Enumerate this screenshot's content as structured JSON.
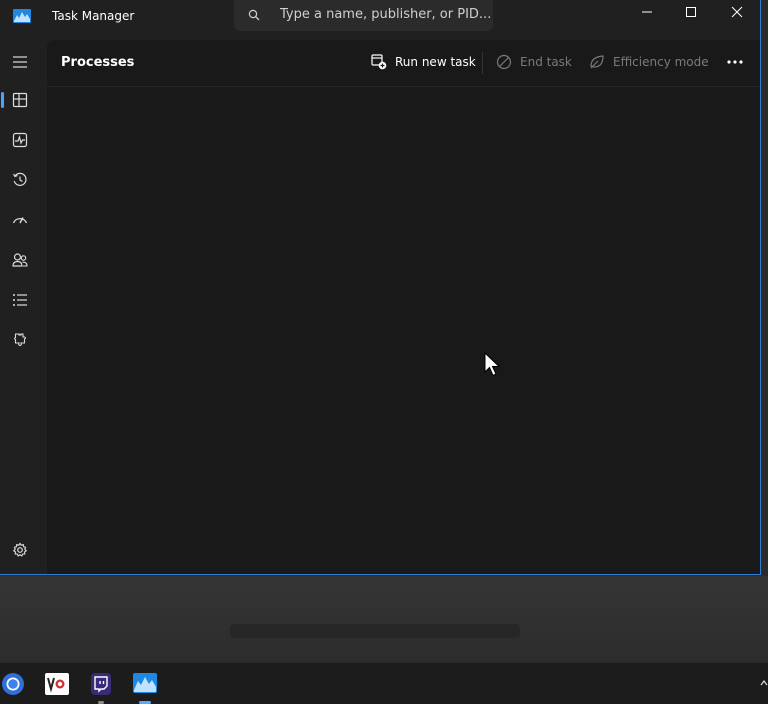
{
  "window": {
    "title": "Task Manager"
  },
  "search": {
    "placeholder": "Type a name, publisher, or PID..."
  },
  "nav": {
    "items": [
      {
        "name": "processes",
        "icon": "processes-icon",
        "selected": true
      },
      {
        "name": "performance",
        "icon": "performance-icon"
      },
      {
        "name": "app-history",
        "icon": "app-history-icon"
      },
      {
        "name": "startup-apps",
        "icon": "startup-apps-icon"
      },
      {
        "name": "users",
        "icon": "users-icon"
      },
      {
        "name": "details",
        "icon": "details-icon"
      },
      {
        "name": "services",
        "icon": "services-icon"
      }
    ],
    "settings_icon": "gear-icon"
  },
  "page": {
    "title": "Processes"
  },
  "toolbar": {
    "run_new_task": "Run new task",
    "end_task": "End task",
    "efficiency_mode": "Efficiency mode"
  },
  "colors": {
    "accent": "#4aa3ff",
    "window_border": "#2e7fd6",
    "disabled_text": "#7a7a7a"
  }
}
